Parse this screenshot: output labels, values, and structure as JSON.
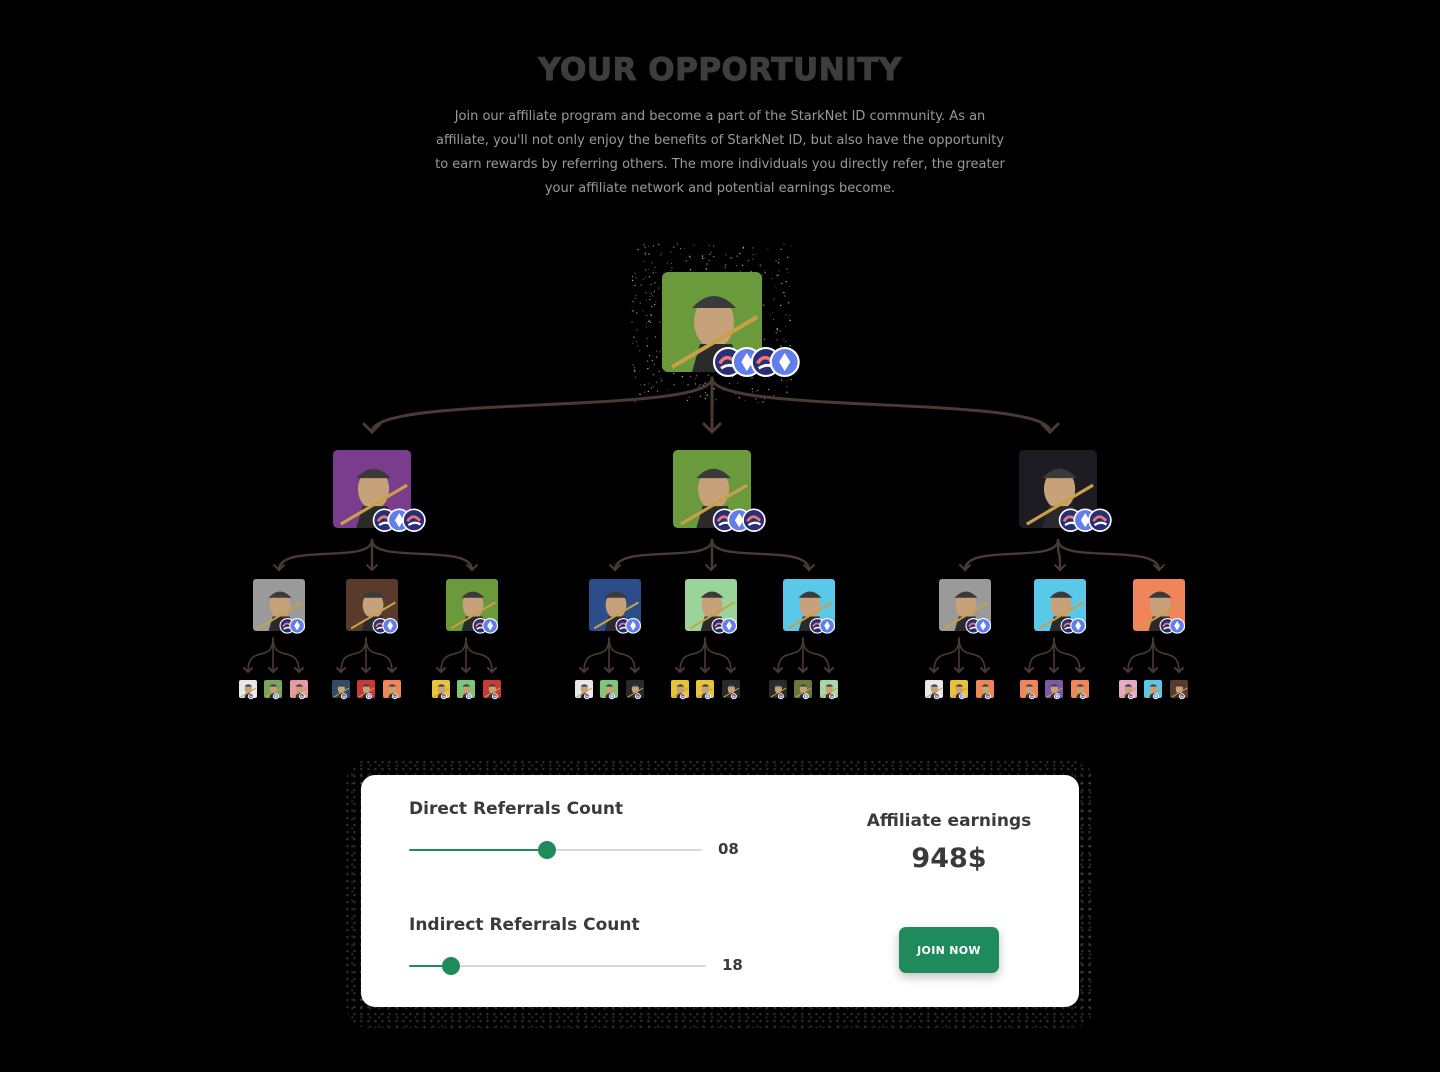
{
  "header": {
    "title": "YOUR OPPORTUNITY",
    "description": "Join our affiliate program and become a part of the StarkNet ID community. As an affiliate, you'll not only enjoy the benefits of StarkNet ID, but also have the opportunity to earn rewards by referring others. The more individuals you directly refer, the greater your affiliate network and potential earnings become."
  },
  "tree": {
    "icons": {
      "avatar": "ape-avatar-icon",
      "starknet_badge": "starknet-badge-icon",
      "ethereum_badge": "ethereum-badge-icon",
      "arrow": "curved-arrow-icon"
    },
    "colors": {
      "arrow": "#4a3a33",
      "starknet": "#2b2d77",
      "ethereum": "#627eea",
      "avatar_face": "#c7a17a"
    },
    "root": {
      "bg": "#6b9a3c"
    },
    "level1": [
      {
        "bg": "#7a3c8c"
      },
      {
        "bg": "#6b9a3c"
      },
      {
        "bg": "#1c1c22"
      }
    ],
    "level2": [
      {
        "bg": "#9a9a9a"
      },
      {
        "bg": "#5a3a2a"
      },
      {
        "bg": "#6b9a3c"
      },
      {
        "bg": "#2d4d8a"
      },
      {
        "bg": "#9ad49a"
      },
      {
        "bg": "#5ac8e8"
      },
      {
        "bg": "#9a9a9a"
      },
      {
        "bg": "#5ac8e8"
      },
      {
        "bg": "#f0845a"
      }
    ],
    "level3": [
      "#e8e8e8",
      "#7aa55a",
      "#e89aa5",
      "#2d4d6a",
      "#c83a3a",
      "#f0845a",
      "#e8c23a",
      "#7ac87a",
      "#c83a3a",
      "#e8e8e8",
      "#7ac87a",
      "#2a2a2a",
      "#e8c23a",
      "#e8c23a",
      "#2a2a2a",
      "#2a2a2a",
      "#6b7a3c",
      "#a8d8a8",
      "#e8e8e8",
      "#e8c23a",
      "#f0845a",
      "#f0845a",
      "#7a5aa8",
      "#f0845a",
      "#e8a8c8",
      "#5ac8e8",
      "#5a3a2a"
    ]
  },
  "calculator": {
    "direct": {
      "label": "Direct Referrals Count",
      "value": "08",
      "fraction": 0.47
    },
    "indirect": {
      "label": "Indirect Referrals Count",
      "value": "18",
      "fraction": 0.14
    },
    "earnings_label": "Affiliate earnings",
    "earnings_value": "948$",
    "join_label": "JOIN NOW",
    "accent": "#1f8a5b"
  }
}
